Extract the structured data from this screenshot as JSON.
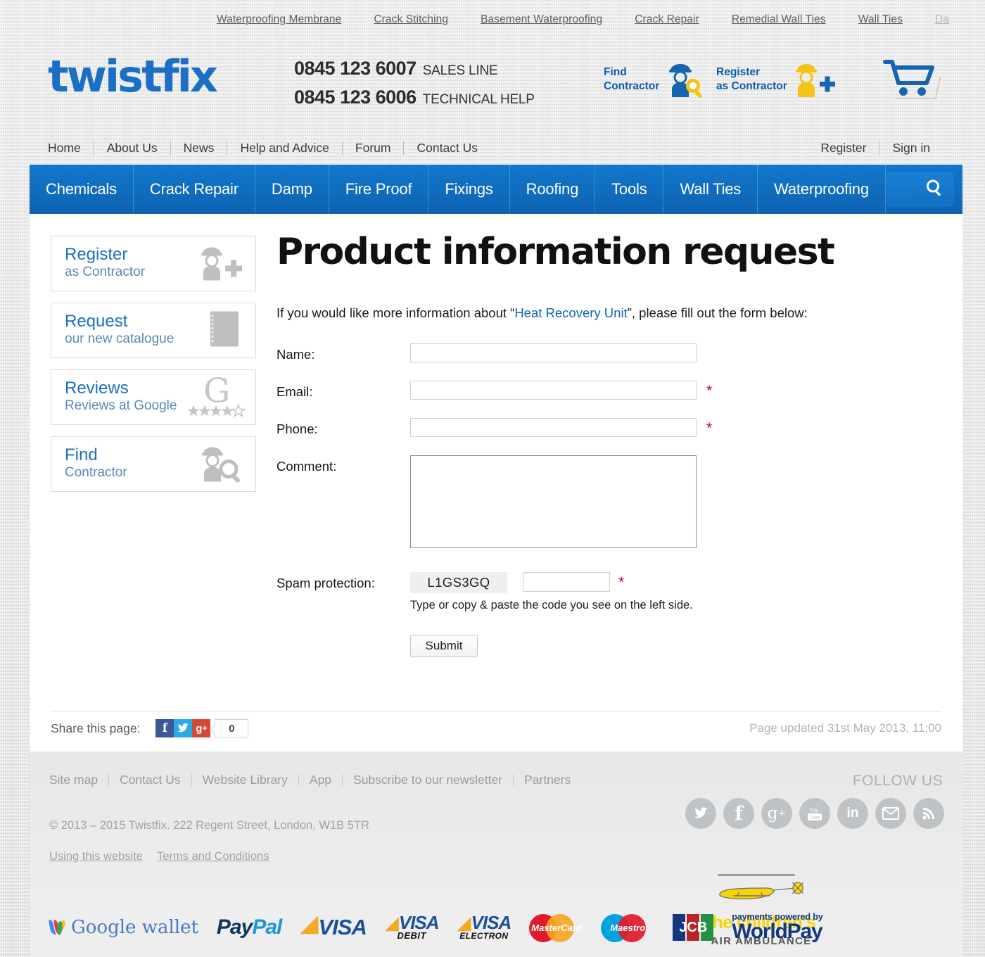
{
  "top_links": [
    {
      "label": "Waterproofing Membrane",
      "faded": false
    },
    {
      "label": "Crack Stitching",
      "faded": false
    },
    {
      "label": "Basement Waterproofing",
      "faded": false
    },
    {
      "label": "Crack Repair",
      "faded": false
    },
    {
      "label": "Remedial Wall Ties",
      "faded": false
    },
    {
      "label": "Wall Ties",
      "faded": false
    },
    {
      "label": "Da",
      "faded": true
    }
  ],
  "header": {
    "logo": "twistfix",
    "phones": [
      {
        "number": "0845 123 6007",
        "label": "SALES LINE"
      },
      {
        "number": "0845 123 6006",
        "label": "TECHNICAL HELP"
      }
    ],
    "find_contractor": {
      "line1": "Find",
      "line2": "Contractor",
      "icon": "contractor-search-icon"
    },
    "register_contractor": {
      "line1": "Register",
      "line2": "as Contractor",
      "icon": "contractor-plus-icon"
    },
    "cart_icon": "shopping-cart-icon"
  },
  "subnav": {
    "left": [
      "Home",
      "About Us",
      "News",
      "Help and Advice",
      "Forum",
      "Contact Us"
    ],
    "right": [
      "Register",
      "Sign in"
    ]
  },
  "mainnav": {
    "items": [
      "Chemicals",
      "Crack Repair",
      "Damp",
      "Fire Proof",
      "Fixings",
      "Roofing",
      "Tools",
      "Wall Ties",
      "Waterproofing"
    ],
    "search_placeholder": "",
    "search_value": "",
    "search_icon": "search-icon",
    "accent_color": "#0e63b2"
  },
  "sidebar": {
    "cards": [
      {
        "title": "Register",
        "subtitle": "as Contractor",
        "icon": "contractor-plus-icon"
      },
      {
        "title": "Request",
        "subtitle": "our new catalogue",
        "icon": "catalogue-icon"
      },
      {
        "title": "Reviews",
        "subtitle": "Reviews at Google",
        "icon": "google-stars-icon",
        "stars_filled": 4,
        "stars_total": 5
      },
      {
        "title": "Find",
        "subtitle": "Contractor",
        "icon": "contractor-search-icon"
      }
    ]
  },
  "main": {
    "title": "Product information request",
    "intro_before": "If you would like more information about “",
    "intro_link": "Heat Recovery Unit",
    "intro_after": "”, please fill out the form below:",
    "form": {
      "name": {
        "label": "Name:",
        "value": "",
        "required": false
      },
      "email": {
        "label": "Email:",
        "value": "",
        "required": true
      },
      "phone": {
        "label": "Phone:",
        "value": "",
        "required": true
      },
      "comment": {
        "label": "Comment:",
        "value": ""
      },
      "spam": {
        "label": "Spam protection:",
        "code": "L1GS3GQ",
        "value": "",
        "required": true,
        "hint": "Type or copy & paste the code you see on the left side."
      },
      "submit_label": "Submit",
      "required_marker": "*"
    }
  },
  "share": {
    "label": "Share this page:",
    "buttons": [
      {
        "name": "facebook",
        "glyph": "f"
      },
      {
        "name": "twitter",
        "glyph": "•"
      },
      {
        "name": "googleplus",
        "glyph": "g+"
      }
    ],
    "count": "0",
    "updated": "Page updated 31st May 2013, 11:00"
  },
  "footer": {
    "links": [
      "Site map",
      "Contact Us",
      "Website Library",
      "App",
      "Subscribe to our newsletter",
      "Partners"
    ],
    "copyright": "© 2013 – 2015 Twistfix. 222 Regent Street, London, W1B 5TR",
    "legal": [
      "Using this website",
      "Terms and Conditions"
    ],
    "follow_label": "FOLLOW US",
    "socials": [
      "twitter-icon",
      "facebook-icon",
      "googleplus-icon",
      "youtube-icon",
      "linkedin-icon",
      "email-icon",
      "rss-icon"
    ],
    "payments": [
      "Google wallet",
      "PayPal",
      "VISA",
      "VISA DEBIT",
      "VISA ELECTRON",
      "MasterCard",
      "Maestro",
      "JCB",
      "payments powered by WorldPay"
    ],
    "charity": {
      "line1": "the children’s",
      "line2": "AIR AMBULANCE",
      "icon": "helicopter-icon"
    }
  }
}
